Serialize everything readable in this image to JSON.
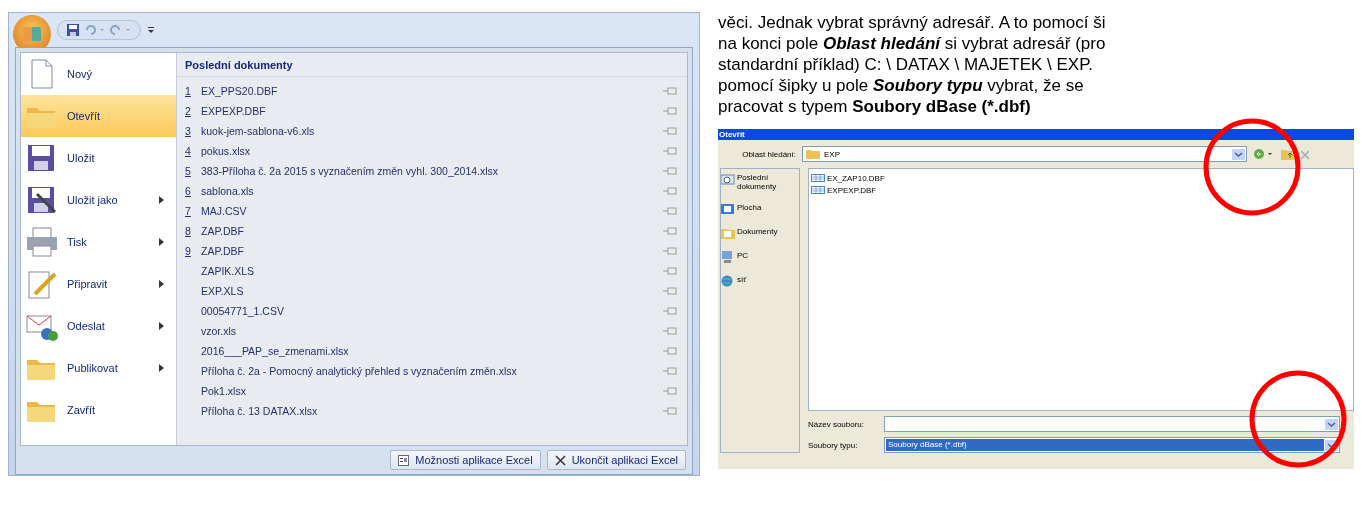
{
  "excel": {
    "menu_items": [
      {
        "label": "Nový",
        "kind": "page",
        "submenu": false,
        "selected": false
      },
      {
        "label": "Otevřít",
        "kind": "folder",
        "submenu": false,
        "selected": true
      },
      {
        "label": "Uložit",
        "kind": "disk",
        "submenu": false,
        "selected": false
      },
      {
        "label": "Uložit jako",
        "kind": "disk-pen",
        "submenu": true,
        "selected": false
      },
      {
        "label": "Tisk",
        "kind": "printer",
        "submenu": true,
        "selected": false
      },
      {
        "label": "Připravit",
        "kind": "pen",
        "submenu": true,
        "selected": false
      },
      {
        "label": "Odeslat",
        "kind": "mail",
        "submenu": true,
        "selected": false
      },
      {
        "label": "Publikovat",
        "kind": "folder",
        "submenu": true,
        "selected": false
      },
      {
        "label": "Zavřít",
        "kind": "folder",
        "submenu": false,
        "selected": false
      }
    ],
    "recent_title": "Poslední dokumenty",
    "recent": [
      {
        "num": "1",
        "name": "EX_PPS20.DBF"
      },
      {
        "num": "2",
        "name": "EXPEXP.DBF"
      },
      {
        "num": "3",
        "name": "kuok-jem-sablona-v6.xls"
      },
      {
        "num": "4",
        "name": "pokus.xlsx"
      },
      {
        "num": "5",
        "name": "383-Příloha č. 2a 2015 s vyznačením změn vyhl. 300_2014.xlsx"
      },
      {
        "num": "6",
        "name": "sablona.xls"
      },
      {
        "num": "7",
        "name": "MAJ.CSV"
      },
      {
        "num": "8",
        "name": "ZAP.DBF"
      },
      {
        "num": "9",
        "name": "ZAP.DBF"
      },
      {
        "name": "ZAPIK.XLS"
      },
      {
        "name": "EXP.XLS"
      },
      {
        "name": "00054771_1.CSV"
      },
      {
        "name": "vzor.xls"
      },
      {
        "name": "2016___PAP_se_zmenami.xlsx"
      },
      {
        "name": "Příloha č. 2a - Pomocný analytický přehled s vyznačením změn.xlsx"
      },
      {
        "name": "Pok1.xlsx"
      },
      {
        "name": "Příloha č. 13 DATAX.xlsx"
      }
    ],
    "buttons": [
      "Možnosti aplikace Excel",
      "Ukončit aplikaci Excel"
    ]
  },
  "paragraph_lines": [
    [
      {
        "kind": "plain",
        "text": "věci. Jednak vybrat správný adresář. A to pomocí ši"
      }
    ],
    [
      {
        "kind": "plain",
        "text": "na konci pole "
      },
      {
        "kind": "bold-italic",
        "text": "Oblast hledání"
      },
      {
        "kind": "plain",
        "text": "  si vybrat adresář (pro"
      }
    ],
    [
      {
        "kind": "plain",
        "text": "standardní příklad) C: \\ DATAX \\ MAJETEK \\ EXP."
      }
    ],
    [
      {
        "kind": "plain",
        "text": "pomocí šipky u pole "
      },
      {
        "kind": "bold-italic",
        "text": "Soubory typu"
      },
      {
        "kind": "plain",
        "text": " vybrat, že se"
      }
    ],
    [
      {
        "kind": "plain",
        "text": "pracovat s typem "
      },
      {
        "kind": "bold",
        "text": "Soubory dBase (*.dbf)"
      }
    ]
  ],
  "dialog": {
    "title": "Otevřít",
    "look_in_label": "Oblast hledání:",
    "look_in_value": "EXP",
    "places": [
      {
        "label": "Poslední dokumenty",
        "kind": "recent"
      },
      {
        "label": "Plocha",
        "kind": "desktop"
      },
      {
        "label": "Dokumenty",
        "kind": "docs"
      },
      {
        "label": "PC",
        "kind": "pc"
      },
      {
        "label": "síť",
        "kind": "network"
      }
    ],
    "files": [
      "EX_ZAP10.DBF",
      "EXPEXP.DBF"
    ],
    "filename_label": "Název souboru:",
    "filetype_label": "Soubory typu:",
    "filetype_value": "Soubory dBase (*.dbf)"
  }
}
